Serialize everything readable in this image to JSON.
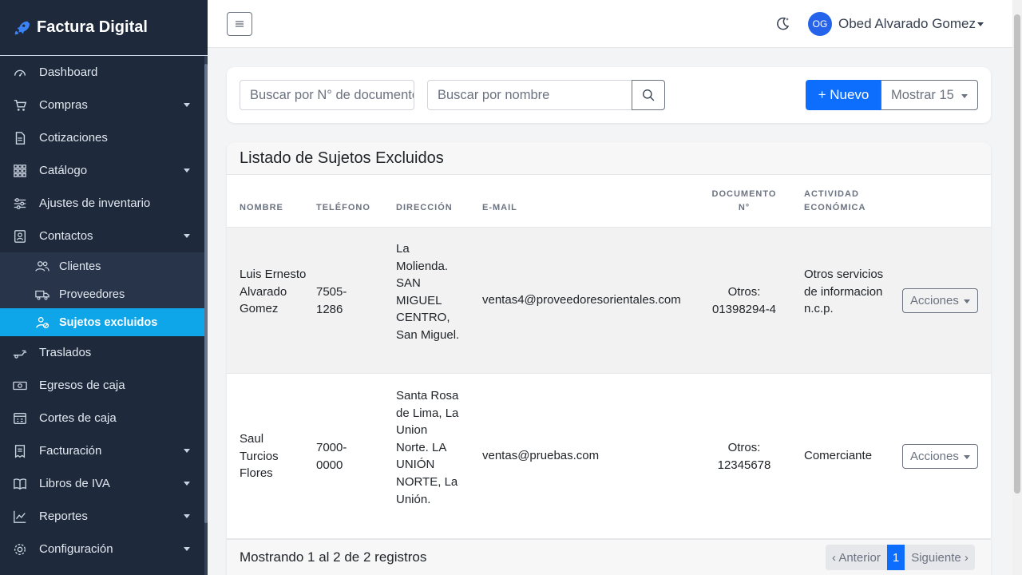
{
  "brand": {
    "name": "Factura Digital"
  },
  "sidebar": {
    "items": [
      {
        "label": "Dashboard",
        "icon": "dashboard-icon"
      },
      {
        "label": "Compras",
        "icon": "cart-icon",
        "has_caret": true
      },
      {
        "label": "Cotizaciones",
        "icon": "document-icon"
      },
      {
        "label": "Catálogo",
        "icon": "grid-icon",
        "has_caret": true
      },
      {
        "label": "Ajustes de inventario",
        "icon": "sliders-icon"
      },
      {
        "label": "Contactos",
        "icon": "contacts-icon",
        "has_caret": true
      }
    ],
    "sub_items": [
      {
        "label": "Clientes",
        "icon": "users-icon"
      },
      {
        "label": "Proveedores",
        "icon": "truck-icon"
      },
      {
        "label": "Sujetos excluidos",
        "icon": "user-excluded-icon",
        "active": true
      }
    ],
    "items_after": [
      {
        "label": "Traslados",
        "icon": "transfer-icon"
      },
      {
        "label": "Egresos de caja",
        "icon": "cash-icon"
      },
      {
        "label": "Cortes de caja",
        "icon": "cash-register-icon"
      },
      {
        "label": "Facturación",
        "icon": "receipt-icon",
        "has_caret": true
      },
      {
        "label": "Libros de IVA",
        "icon": "book-icon",
        "has_caret": true
      },
      {
        "label": "Reportes",
        "icon": "chart-icon",
        "has_caret": true
      },
      {
        "label": "Configuración",
        "icon": "gear-icon",
        "has_caret": true
      }
    ]
  },
  "topbar": {
    "avatar_initials": "OG",
    "user_name": "Obed Alvarado Gomez"
  },
  "search": {
    "doc_placeholder": "Buscar por N° de documento",
    "name_placeholder": "Buscar por nombre",
    "new_label": "+ Nuevo",
    "show_label": "Mostrar 15"
  },
  "table": {
    "title": "Listado de Sujetos Excluidos",
    "headers": {
      "nombre": "NOMBRE",
      "telefono": "TELÉFONO",
      "direccion": "DIRECCIÓN",
      "email": "E-MAIL",
      "documento_1": "DOCUMENTO",
      "documento_2": "N°",
      "actividad_1": "ACTIVIDAD",
      "actividad_2": "ECONÓMICA"
    },
    "rows": [
      {
        "nombre": "Luis Ernesto Alvarado Gomez",
        "telefono": "7505-1286",
        "direccion": "La Molienda. SAN MIGUEL CENTRO, San Miguel.",
        "email": "ventas4@proveedoresorientales.com",
        "documento_1": "Otros:",
        "documento_2": "01398294-4",
        "actividad": "Otros servicios de informacion n.c.p.",
        "acciones": "Acciones"
      },
      {
        "nombre": "Saul Turcios Flores",
        "telefono": "7000-0000",
        "direccion": "Santa Rosa de Lima, La Union Norte. LA UNIÓN NORTE, La Unión.",
        "email": "ventas@pruebas.com",
        "documento_1": "Otros:",
        "documento_2": "12345678",
        "actividad": "Comerciante",
        "acciones": "Acciones"
      }
    ],
    "footer": "Mostrando 1 al 2 de 2 registros",
    "pager": {
      "prev": "‹ Anterior",
      "page": "1",
      "next": "Siguiente ›"
    }
  },
  "colors": {
    "sidebar_bg": "#1e293b",
    "active_item": "#0ea5e9",
    "primary": "#0d6efd"
  }
}
